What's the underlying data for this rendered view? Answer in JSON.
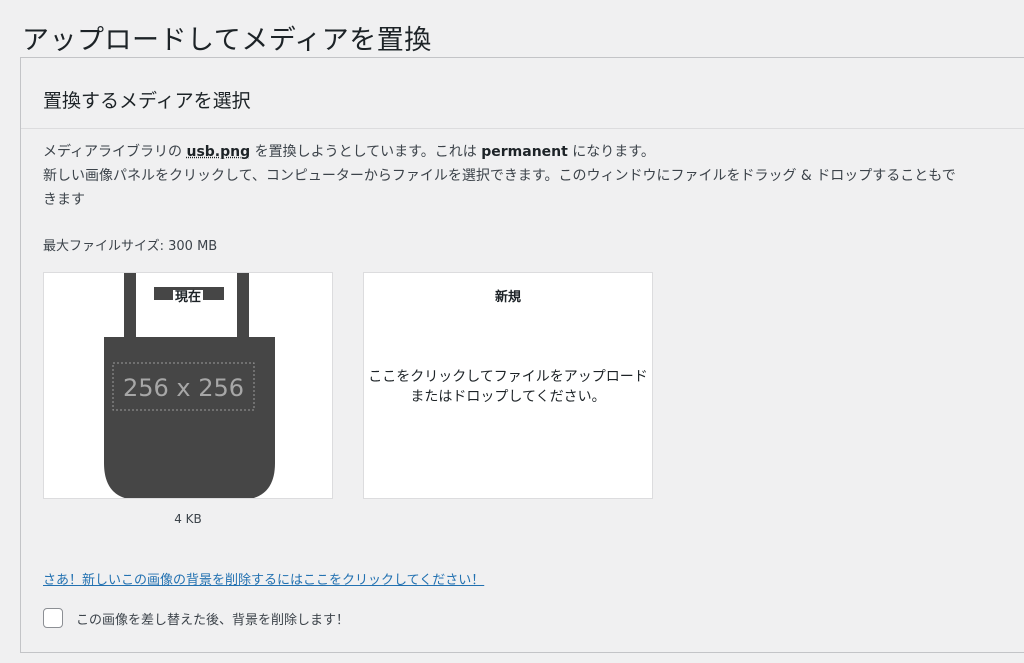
{
  "page": {
    "title": "アップロードしてメディアを置換"
  },
  "section": {
    "title": "置換するメディアを選択",
    "desc_part1": "メディアライブラリの ",
    "filename": "usb.png",
    "desc_part2": " を置換しようとしています。これは ",
    "permanent": "permanent",
    "desc_part3": " になります。",
    "desc_line2": "新しい画像パネルをクリックして、コンピューターからファイルを選択できます。このウィンドウにファイルをドラッグ & ドロップすることもできます",
    "max_file_size": "最大ファイルサイズ: 300 MB"
  },
  "current": {
    "label": "現在",
    "placeholder_text": "256 x 256",
    "file_size": "4 KB",
    "icon": "bag-icon"
  },
  "new_panel": {
    "label": "新規",
    "instructions": "ここをクリックしてファイルをアップロードまたはドロップしてください。"
  },
  "remove_background_link": "さあ！新しいこの画像の背景を削除するにはここをクリックしてください！",
  "remove_background_checkbox": {
    "label": "この画像を差し替えた後、背景を削除します！",
    "checked": false
  }
}
